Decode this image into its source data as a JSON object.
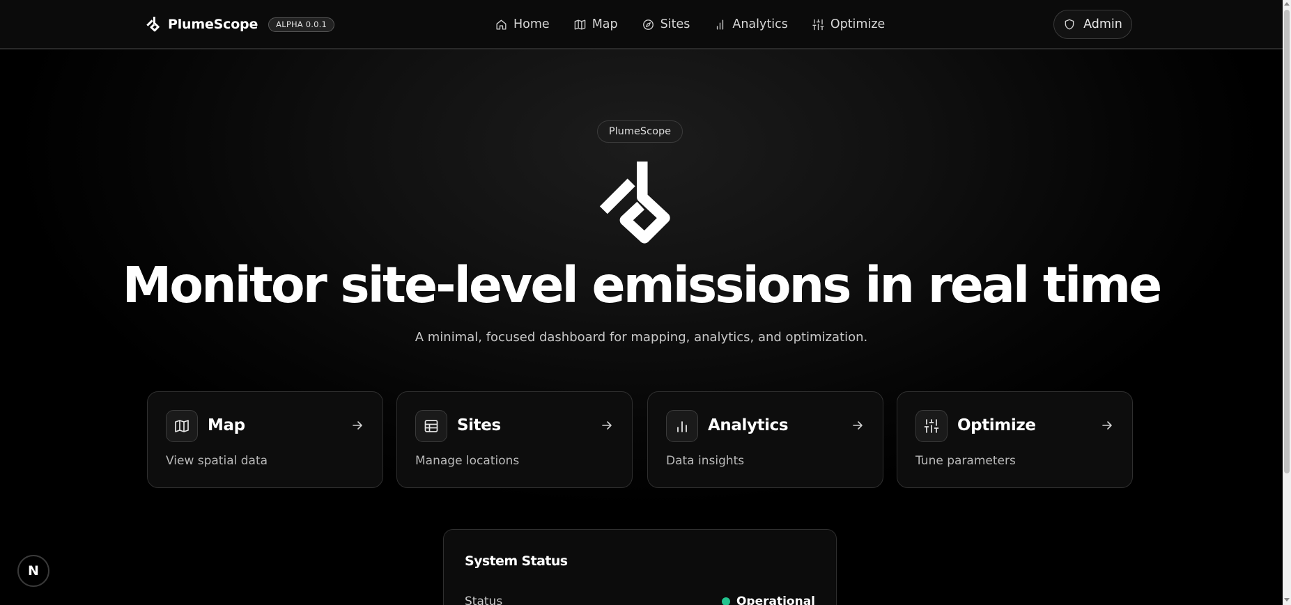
{
  "header": {
    "brand_name": "PlumeScope",
    "version_badge": "ALPHA 0.0.1",
    "nav": [
      {
        "label": "Home",
        "icon": "home-icon"
      },
      {
        "label": "Map",
        "icon": "map-icon"
      },
      {
        "label": "Sites",
        "icon": "compass-icon"
      },
      {
        "label": "Analytics",
        "icon": "bar-chart-icon"
      },
      {
        "label": "Optimize",
        "icon": "sliders-icon"
      }
    ],
    "admin_label": "Admin",
    "admin_icon": "shield-icon"
  },
  "hero": {
    "badge": "PlumeScope",
    "title": "Monitor site-level emissions in real time",
    "subtitle": "A minimal, focused dashboard for mapping, analytics, and optimization."
  },
  "cards": [
    {
      "title": "Map",
      "description": "View spatial data",
      "icon": "map-icon"
    },
    {
      "title": "Sites",
      "description": "Manage locations",
      "icon": "table-icon"
    },
    {
      "title": "Analytics",
      "description": "Data insights",
      "icon": "bar-chart-icon"
    },
    {
      "title": "Optimize",
      "description": "Tune parameters",
      "icon": "sliders-icon"
    }
  ],
  "system_status": {
    "title": "System Status",
    "status_label": "Status",
    "status_value": "Operational",
    "status_color": "#22c38e"
  },
  "dev_indicator": {
    "label": "N"
  },
  "colors": {
    "background": "#000000",
    "header_background": "#0b0b0b",
    "card_background": "#0d0d0d",
    "accent_green": "#22c38e"
  }
}
